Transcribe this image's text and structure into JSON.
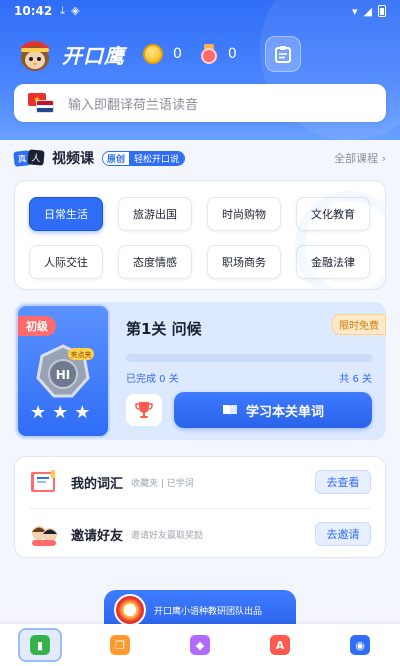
{
  "status_bar": {
    "time": "10:42"
  },
  "header": {
    "app_title": "开口鹰",
    "coins": "0",
    "medals": "0"
  },
  "search": {
    "placeholder": "输入即翻译荷兰语读音"
  },
  "section": {
    "badge_a": "真",
    "badge_b": "人",
    "title": "视频课",
    "tag_left": "原创",
    "tag_right": "轻松开口说",
    "all_courses": "全部课程 ›"
  },
  "categories": [
    {
      "label": "日常生活",
      "active": true
    },
    {
      "label": "旅游出国",
      "active": false
    },
    {
      "label": "时尚购物",
      "active": false
    },
    {
      "label": "文化教育",
      "active": false
    },
    {
      "label": "人际交往",
      "active": false
    },
    {
      "label": "态度情感",
      "active": false
    },
    {
      "label": "职场商务",
      "active": false
    },
    {
      "label": "金融法律",
      "active": false
    }
  ],
  "lesson": {
    "level": "初级",
    "medal_tag": "夹点夹",
    "medal_text": "HI",
    "title": "第1关 问候",
    "limited": "限时免费",
    "completed_text": "已完成 0 关",
    "total_text": "共 6 关",
    "progress": 0,
    "study_button": "学习本关单词"
  },
  "list": [
    {
      "title": "我的词汇",
      "subtitle": "收藏夹 | 已学词",
      "button": "去查看"
    },
    {
      "title": "邀请好友",
      "subtitle": "邀请好友赢取奖励",
      "button": "去邀请"
    }
  ],
  "banner": {
    "text": "开口鹰小语种教研团队出品"
  },
  "tabs": [
    {
      "name": "home",
      "color": "#35b34a",
      "glyph": "▮"
    },
    {
      "name": "courses",
      "color": "#ff9a2e",
      "glyph": "❐"
    },
    {
      "name": "vip",
      "color": "#b26bff",
      "glyph": "◆"
    },
    {
      "name": "dictionary",
      "color": "#ff5a4e",
      "glyph": "A"
    },
    {
      "name": "profile",
      "color": "#2f6df6",
      "glyph": "◉"
    }
  ]
}
